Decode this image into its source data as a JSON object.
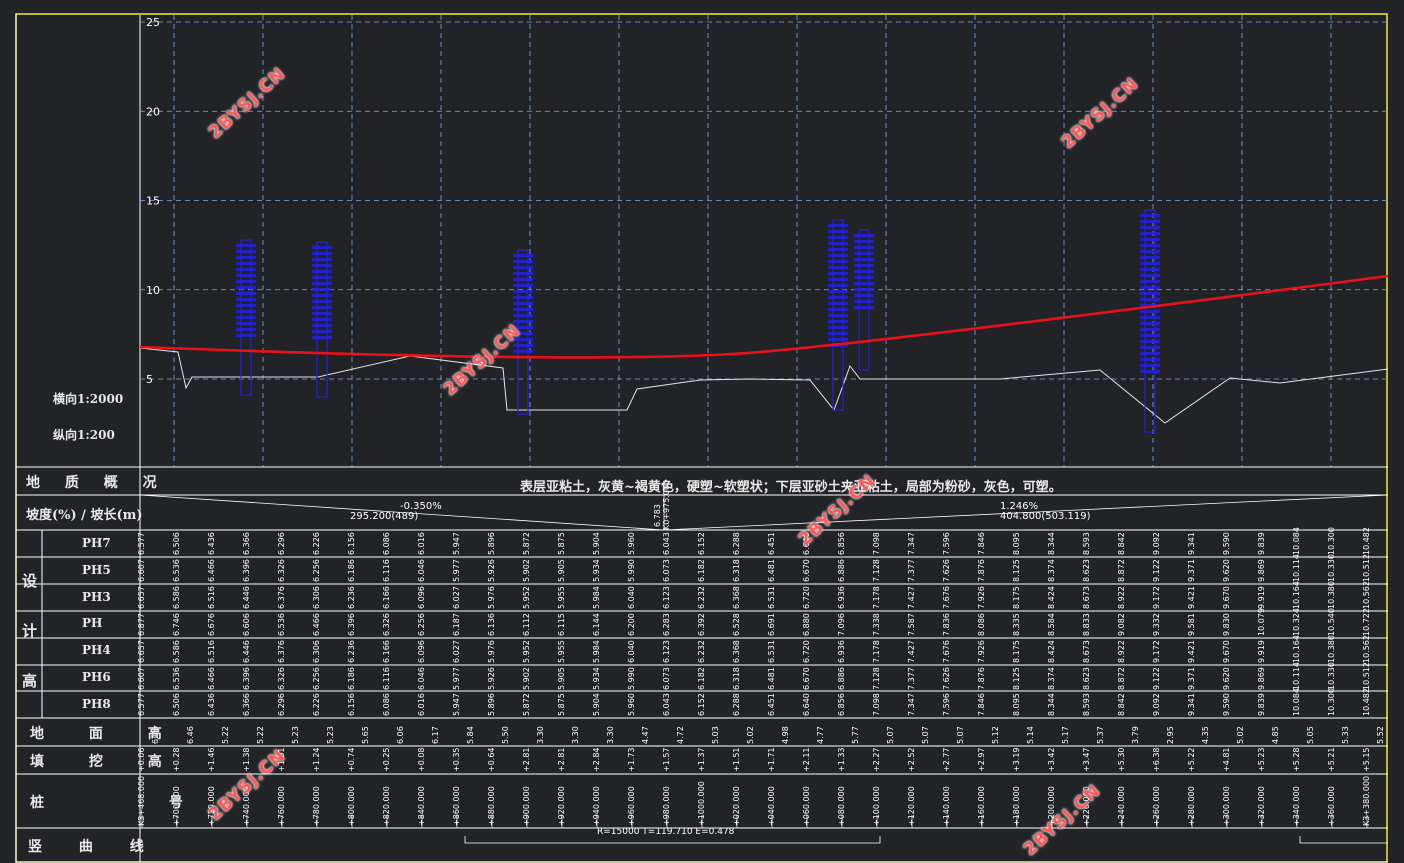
{
  "scale": {
    "horizontal": "横向1:2000",
    "vertical": "纵向1:200"
  },
  "y_ticks": [
    "25",
    "20",
    "15",
    "10",
    "5"
  ],
  "rows": {
    "geology": "地 质 概 况",
    "slope": "坡度(%) / 坡长(m)",
    "design": "设 计 高",
    "ground": "地 面 高",
    "fill": "填 挖 高",
    "stake": "桩 号",
    "vcurve": "竖 曲 线"
  },
  "design_sub": [
    "PH7",
    "PH5",
    "PH3",
    "PH",
    "PH4",
    "PH6",
    "PH8"
  ],
  "design_chars": [
    "设",
    "计",
    "高"
  ],
  "geology_text": "表层亚粘土，灰黄~褐黄色，硬塑~软塑状；下层亚砂土夹亚粘土，局部为粉砂，灰色，可塑。",
  "slope": [
    {
      "grade": "-0.350%",
      "length": "295.200(489)"
    },
    {
      "grade": "1.246%",
      "length": "404.800(503.119)"
    }
  ],
  "pvi": {
    "elev": "6.783",
    "station": "K0+975.000"
  },
  "vcurve_text": "R=15000   T=119.710   E=0.478",
  "columns": [
    {
      "stake": "K3+468.000",
      "PH7": "6.577",
      "PH5": "6.607",
      "PH3": "6.657",
      "PH": "6.877",
      "PH4": "6.657",
      "PH6": "6.607",
      "PH8": "6.577",
      "ground": "6.76",
      "fill": "+0.06"
    },
    {
      "stake": "+700.000",
      "PH7": "6.506",
      "PH5": "6.536",
      "PH3": "6.586",
      "PH": "6.746",
      "PH4": "6.586",
      "PH6": "6.536",
      "PH8": "6.506",
      "ground": "6.46",
      "fill": "+0.28"
    },
    {
      "stake": "+720.000",
      "PH7": "6.436",
      "PH5": "6.466",
      "PH3": "6.516",
      "PH": "6.676",
      "PH4": "6.516",
      "PH6": "6.466",
      "PH8": "6.436",
      "ground": "5.22",
      "fill": "+1.46"
    },
    {
      "stake": "+740.000",
      "PH7": "6.366",
      "PH5": "6.396",
      "PH3": "6.446",
      "PH": "6.606",
      "PH4": "6.446",
      "PH6": "6.396",
      "PH8": "6.366",
      "ground": "5.22",
      "fill": "+1.38"
    },
    {
      "stake": "+760.000",
      "PH7": "6.296",
      "PH5": "6.326",
      "PH3": "6.376",
      "PH": "6.536",
      "PH4": "6.376",
      "PH6": "6.326",
      "PH8": "6.296",
      "ground": "5.23",
      "fill": "+1.31"
    },
    {
      "stake": "+780.000",
      "PH7": "6.226",
      "PH5": "6.256",
      "PH3": "6.306",
      "PH": "6.466",
      "PH4": "6.306",
      "PH6": "6.256",
      "PH8": "6.226",
      "ground": "5.23",
      "fill": "+1.24"
    },
    {
      "stake": "+800.000",
      "PH7": "6.156",
      "PH5": "6.186",
      "PH3": "6.236",
      "PH": "6.396",
      "PH4": "6.236",
      "PH6": "6.186",
      "PH8": "6.156",
      "ground": "5.65",
      "fill": "+0.74"
    },
    {
      "stake": "+820.000",
      "PH7": "6.086",
      "PH5": "6.116",
      "PH3": "6.166",
      "PH": "6.326",
      "PH4": "6.166",
      "PH6": "6.116",
      "PH8": "6.086",
      "ground": "6.06",
      "fill": "+0.25"
    },
    {
      "stake": "+840.000",
      "PH7": "6.016",
      "PH5": "6.046",
      "PH3": "6.096",
      "PH": "6.256",
      "PH4": "6.096",
      "PH6": "6.046",
      "PH8": "6.016",
      "ground": "6.17",
      "fill": "+0.08"
    },
    {
      "stake": "+860.000",
      "PH7": "5.947",
      "PH5": "5.977",
      "PH3": "6.027",
      "PH": "6.187",
      "PH4": "6.027",
      "PH6": "5.977",
      "PH8": "5.947",
      "ground": "5.84",
      "fill": "+0.35"
    },
    {
      "stake": "+880.000",
      "PH7": "5.896",
      "PH5": "5.926",
      "PH3": "5.976",
      "PH": "6.136",
      "PH4": "5.976",
      "PH6": "5.926",
      "PH8": "5.896",
      "ground": "5.50",
      "fill": "+0.64"
    },
    {
      "stake": "+900.000",
      "PH7": "5.872",
      "PH5": "5.902",
      "PH3": "5.952",
      "PH": "6.112",
      "PH4": "5.952",
      "PH6": "5.902",
      "PH8": "5.872",
      "ground": "3.30",
      "fill": "+2.81"
    },
    {
      "stake": "+920.000",
      "PH7": "5.875",
      "PH5": "5.905",
      "PH3": "5.955",
      "PH": "6.115",
      "PH4": "5.955",
      "PH6": "5.905",
      "PH8": "5.875",
      "ground": "3.30",
      "fill": "+2.81"
    },
    {
      "stake": "+940.000",
      "PH7": "5.904",
      "PH5": "5.934",
      "PH3": "5.984",
      "PH": "6.144",
      "PH4": "5.984",
      "PH6": "5.934",
      "PH8": "5.904",
      "ground": "3.30",
      "fill": "+2.84"
    },
    {
      "stake": "+960.000",
      "PH7": "5.960",
      "PH5": "5.990",
      "PH3": "6.040",
      "PH": "6.200",
      "PH4": "6.040",
      "PH6": "5.990",
      "PH8": "5.960",
      "ground": "4.47",
      "fill": "+1.73"
    },
    {
      "stake": "+980.000",
      "PH7": "6.043",
      "PH5": "6.073",
      "PH3": "6.123",
      "PH": "6.283",
      "PH4": "6.123",
      "PH6": "6.073",
      "PH8": "6.043",
      "ground": "4.72",
      "fill": "+1.57"
    },
    {
      "stake": "+1000.000",
      "PH7": "6.152",
      "PH5": "6.182",
      "PH3": "6.232",
      "PH": "6.392",
      "PH4": "6.232",
      "PH6": "6.182",
      "PH8": "6.152",
      "ground": "5.03",
      "fill": "+1.37"
    },
    {
      "stake": "+020.000",
      "PH7": "6.288",
      "PH5": "6.318",
      "PH3": "6.368",
      "PH": "6.528",
      "PH4": "6.368",
      "PH6": "6.318",
      "PH8": "6.288",
      "ground": "5.02",
      "fill": "+1.51"
    },
    {
      "stake": "+040.000",
      "PH7": "6.451",
      "PH5": "6.481",
      "PH3": "6.531",
      "PH": "6.691",
      "PH4": "6.531",
      "PH6": "6.481",
      "PH8": "6.451",
      "ground": "4.98",
      "fill": "+1.71"
    },
    {
      "stake": "+060.000",
      "PH7": "6.640",
      "PH5": "6.670",
      "PH3": "6.720",
      "PH": "6.880",
      "PH4": "6.720",
      "PH6": "6.670",
      "PH8": "6.640",
      "ground": "4.77",
      "fill": "+2.11"
    },
    {
      "stake": "+080.000",
      "PH7": "6.856",
      "PH5": "6.886",
      "PH3": "6.936",
      "PH": "7.096",
      "PH4": "6.936",
      "PH6": "6.886",
      "PH8": "6.856",
      "ground": "5.77",
      "fill": "+1.33"
    },
    {
      "stake": "+100.000",
      "PH7": "7.098",
      "PH5": "7.128",
      "PH3": "7.178",
      "PH": "7.338",
      "PH4": "7.178",
      "PH6": "7.128",
      "PH8": "7.098",
      "ground": "5.07",
      "fill": "+2.27"
    },
    {
      "stake": "+120.000",
      "PH7": "7.347",
      "PH5": "7.377",
      "PH3": "7.427",
      "PH": "7.587",
      "PH4": "7.427",
      "PH6": "7.377",
      "PH8": "7.347",
      "ground": "5.07",
      "fill": "+2.52"
    },
    {
      "stake": "+140.000",
      "PH7": "7.596",
      "PH5": "7.626",
      "PH3": "7.676",
      "PH": "7.836",
      "PH4": "7.676",
      "PH6": "7.626",
      "PH8": "7.596",
      "ground": "5.07",
      "fill": "+2.77"
    },
    {
      "stake": "+160.000",
      "PH7": "7.846",
      "PH5": "7.876",
      "PH3": "7.926",
      "PH": "8.086",
      "PH4": "7.926",
      "PH6": "7.876",
      "PH8": "7.846",
      "ground": "5.12",
      "fill": "+2.97"
    },
    {
      "stake": "+180.000",
      "PH7": "8.095",
      "PH5": "8.125",
      "PH3": "8.175",
      "PH": "8.335",
      "PH4": "8.175",
      "PH6": "8.125",
      "PH8": "8.095",
      "ground": "5.14",
      "fill": "+3.19"
    },
    {
      "stake": "+200.000",
      "PH7": "8.344",
      "PH5": "8.374",
      "PH3": "8.424",
      "PH": "8.584",
      "PH4": "8.424",
      "PH6": "8.374",
      "PH8": "8.344",
      "ground": "5.17",
      "fill": "+3.42"
    },
    {
      "stake": "+220.000",
      "PH7": "8.593",
      "PH5": "8.623",
      "PH3": "8.673",
      "PH": "8.833",
      "PH4": "8.673",
      "PH6": "8.623",
      "PH8": "8.593",
      "ground": "5.37",
      "fill": "+3.47"
    },
    {
      "stake": "+240.000",
      "PH7": "8.842",
      "PH5": "8.872",
      "PH3": "8.922",
      "PH": "9.082",
      "PH4": "8.922",
      "PH6": "8.872",
      "PH8": "8.842",
      "ground": "3.79",
      "fill": "+5.30"
    },
    {
      "stake": "+260.000",
      "PH7": "9.092",
      "PH5": "9.122",
      "PH3": "9.172",
      "PH": "9.332",
      "PH4": "9.172",
      "PH6": "9.122",
      "PH8": "9.092",
      "ground": "2.95",
      "fill": "+6.38"
    },
    {
      "stake": "+280.000",
      "PH7": "9.341",
      "PH5": "9.371",
      "PH3": "9.421",
      "PH": "9.581",
      "PH4": "9.421",
      "PH6": "9.371",
      "PH8": "9.341",
      "ground": "4.35",
      "fill": "+5.22"
    },
    {
      "stake": "+300.000",
      "PH7": "9.590",
      "PH5": "9.620",
      "PH3": "9.670",
      "PH": "9.830",
      "PH4": "9.670",
      "PH6": "9.620",
      "PH8": "9.590",
      "ground": "5.02",
      "fill": "+4.81"
    },
    {
      "stake": "+320.000",
      "PH7": "9.839",
      "PH5": "9.869",
      "PH3": "9.919",
      "PH": "10.079",
      "PH4": "9.919",
      "PH6": "9.869",
      "PH8": "9.839",
      "ground": "4.85",
      "fill": "+5.23"
    },
    {
      "stake": "+340.000",
      "PH7": "10.084",
      "PH5": "10.114",
      "PH3": "10.164",
      "PH": "10.324",
      "PH4": "10.164",
      "PH6": "10.114",
      "PH8": "10.084",
      "ground": "5.05",
      "fill": "+5.28"
    },
    {
      "stake": "+360.000",
      "PH7": "10.300",
      "PH5": "10.330",
      "PH3": "10.380",
      "PH": "10.540",
      "PH4": "10.380",
      "PH6": "10.330",
      "PH8": "10.300",
      "ground": "5.33",
      "fill": "+5.21"
    },
    {
      "stake": "K3+380.000",
      "PH7": "10.482",
      "PH5": "10.512",
      "PH3": "10.562",
      "PH": "10.722",
      "PH4": "10.562",
      "PH6": "10.512",
      "PH8": "10.482",
      "ground": "5.52",
      "fill": "+5.15"
    }
  ],
  "watermark": "2BYSJ.CN",
  "colors": {
    "background": "#212326",
    "grid": "#7fa7e8",
    "design_line": "#e8121b",
    "ground_line": "#e6e6e6",
    "markers": "#2222dd",
    "border": "#f2ea3a",
    "watermark": "#ff5a5a"
  }
}
